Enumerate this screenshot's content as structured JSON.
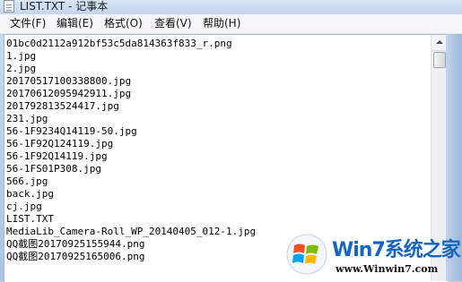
{
  "window": {
    "title": "LIST.TXT - 记事本"
  },
  "menu": [
    {
      "label": "文件(F)"
    },
    {
      "label": "编辑(E)"
    },
    {
      "label": "格式(O)"
    },
    {
      "label": "查看(V)"
    },
    {
      "label": "帮助(H)"
    }
  ],
  "editor": {
    "lines": [
      "01bc0d2112a912bf53c5da814363f833_r.png",
      "1.jpg",
      "2.jpg",
      "20170517100338800.jpg",
      "20170612095942911.jpg",
      "201792813524417.jpg",
      "231.jpg",
      "56-1F9234Q14119-50.jpg",
      "56-1F92Q124119.jpg",
      "56-1F92Q14119.jpg",
      "56-1FS01P308.jpg",
      "566.jpg",
      "back.jpg",
      "cj.jpg",
      "LIST.TXT",
      "MediaLib_Camera-Roll_WP_20140405_012-1.jpg",
      "QQ截图20170925155944.png",
      "QQ截图20170925165006.png"
    ]
  },
  "watermark": {
    "brand": "Win7系统之家",
    "url": "www.Winwin7.com",
    "icon": "windows-flag-logo"
  }
}
